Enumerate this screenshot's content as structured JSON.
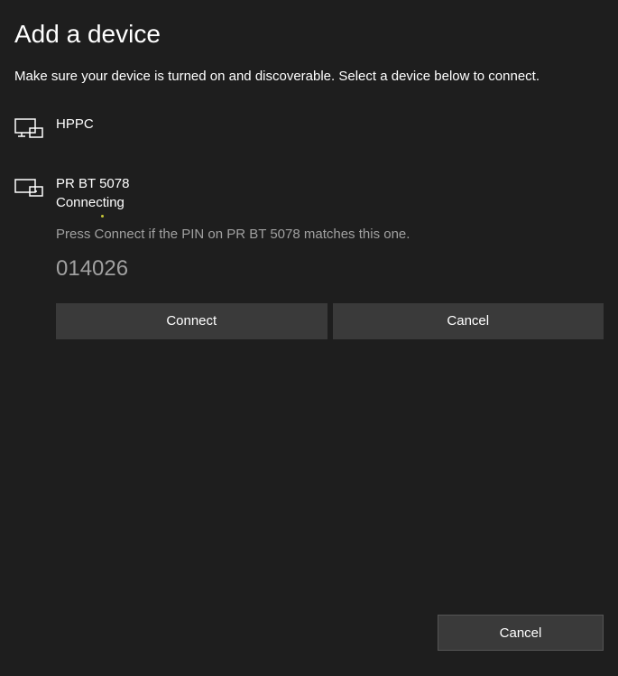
{
  "dialog": {
    "title": "Add a device",
    "subtitle": "Make sure your device is turned on and discoverable. Select a device below to connect."
  },
  "devices": [
    {
      "name": "HPPC",
      "icon": "monitor-pc"
    },
    {
      "name": "PR BT 5078",
      "icon": "display-device",
      "status": "Connecting",
      "pairing": {
        "hint": "Press Connect if the PIN on PR BT 5078 matches this one.",
        "pin": "014026",
        "connect_label": "Connect",
        "cancel_label": "Cancel"
      }
    }
  ],
  "footer": {
    "cancel_label": "Cancel"
  }
}
